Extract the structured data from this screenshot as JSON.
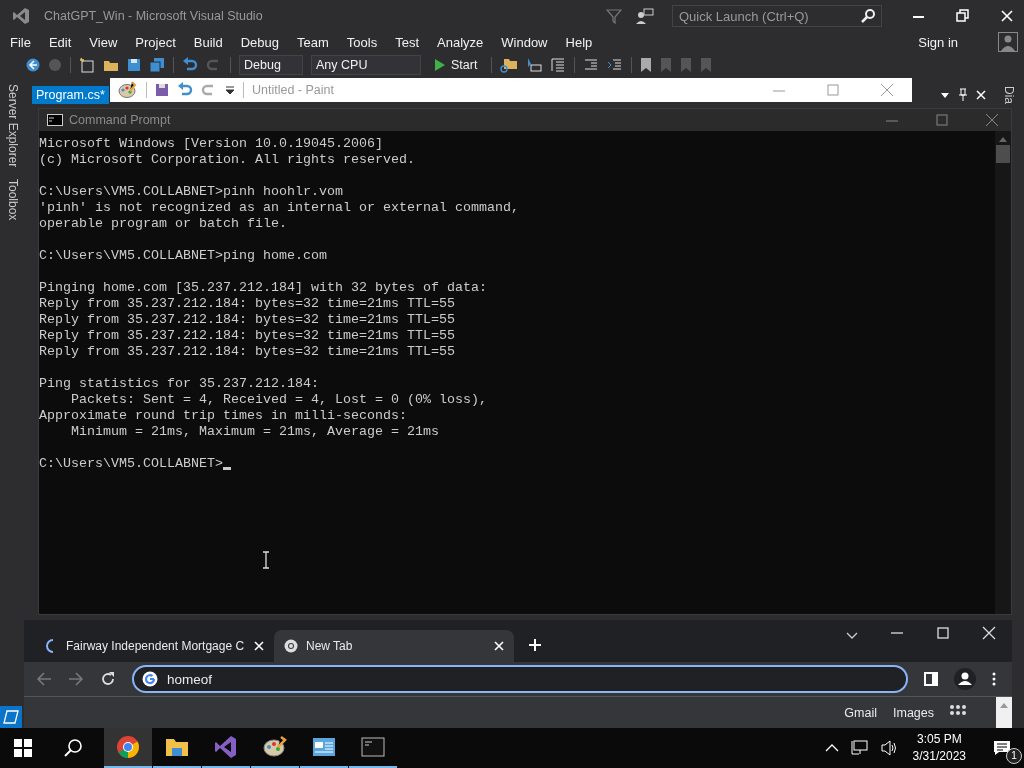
{
  "vs": {
    "title": "ChatGPT_Win - Microsoft Visual Studio",
    "quick_launch": {
      "placeholder": "Quick Launch (Ctrl+Q)"
    },
    "menu": [
      "File",
      "Edit",
      "View",
      "Project",
      "Build",
      "Debug",
      "Team",
      "Tools",
      "Test",
      "Analyze",
      "Window",
      "Help"
    ],
    "sign_in": "Sign in",
    "toolbar": {
      "configuration": "Debug",
      "platform": "Any CPU",
      "start": "Start"
    },
    "side_tabs": [
      "Server Explorer",
      "Toolbox"
    ],
    "right_side_tab": "Dia",
    "document_tab": {
      "label": "Program.cs*",
      "selected": true
    }
  },
  "paint": {
    "title": "Untitled - Paint"
  },
  "cmd": {
    "title": "Command Prompt",
    "cursor": true,
    "blocks": [
      [
        "Microsoft Windows [Version 10.0.19045.2006]",
        "(c) Microsoft Corporation. All rights reserved."
      ],
      [
        "C:\\Users\\VM5.COLLABNET>pinh hoohlr.vom",
        "'pinh' is not recognized as an internal or external command,",
        "operable program or batch file."
      ],
      [
        "C:\\Users\\VM5.COLLABNET>ping home.com"
      ],
      [
        "Pinging home.com [35.237.212.184] with 32 bytes of data:",
        "Reply from 35.237.212.184: bytes=32 time=21ms TTL=55",
        "Reply from 35.237.212.184: bytes=32 time=21ms TTL=55",
        "Reply from 35.237.212.184: bytes=32 time=21ms TTL=55",
        "Reply from 35.237.212.184: bytes=32 time=21ms TTL=55"
      ],
      [
        "Ping statistics for 35.237.212.184:",
        "    Packets: Sent = 4, Received = 4, Lost = 0 (0% loss),",
        "Approximate round trip times in milli-seconds:",
        "    Minimum = 21ms, Maximum = 21ms, Average = 21ms"
      ],
      [
        "C:\\Users\\VM5.COLLABNET>"
      ]
    ]
  },
  "chrome": {
    "tabs": [
      {
        "label": "Fairway Independent Mortgage C",
        "kind": "loading",
        "selected": false
      },
      {
        "label": "New Tab",
        "kind": "chrome",
        "selected": true
      }
    ],
    "address": {
      "value": "homeof"
    },
    "links": [
      "Gmail",
      "Images"
    ]
  },
  "taskbar": {
    "apps": [
      {
        "kind": "chrome",
        "selected": true
      },
      {
        "kind": "explorer",
        "selected": false
      },
      {
        "kind": "studio",
        "selected": false
      },
      {
        "kind": "paint",
        "selected": false
      },
      {
        "kind": "window",
        "selected": false
      },
      {
        "kind": "console",
        "selected": false
      }
    ],
    "time": "3:05 PM",
    "date": "3/31/2023",
    "notifications": "1"
  }
}
